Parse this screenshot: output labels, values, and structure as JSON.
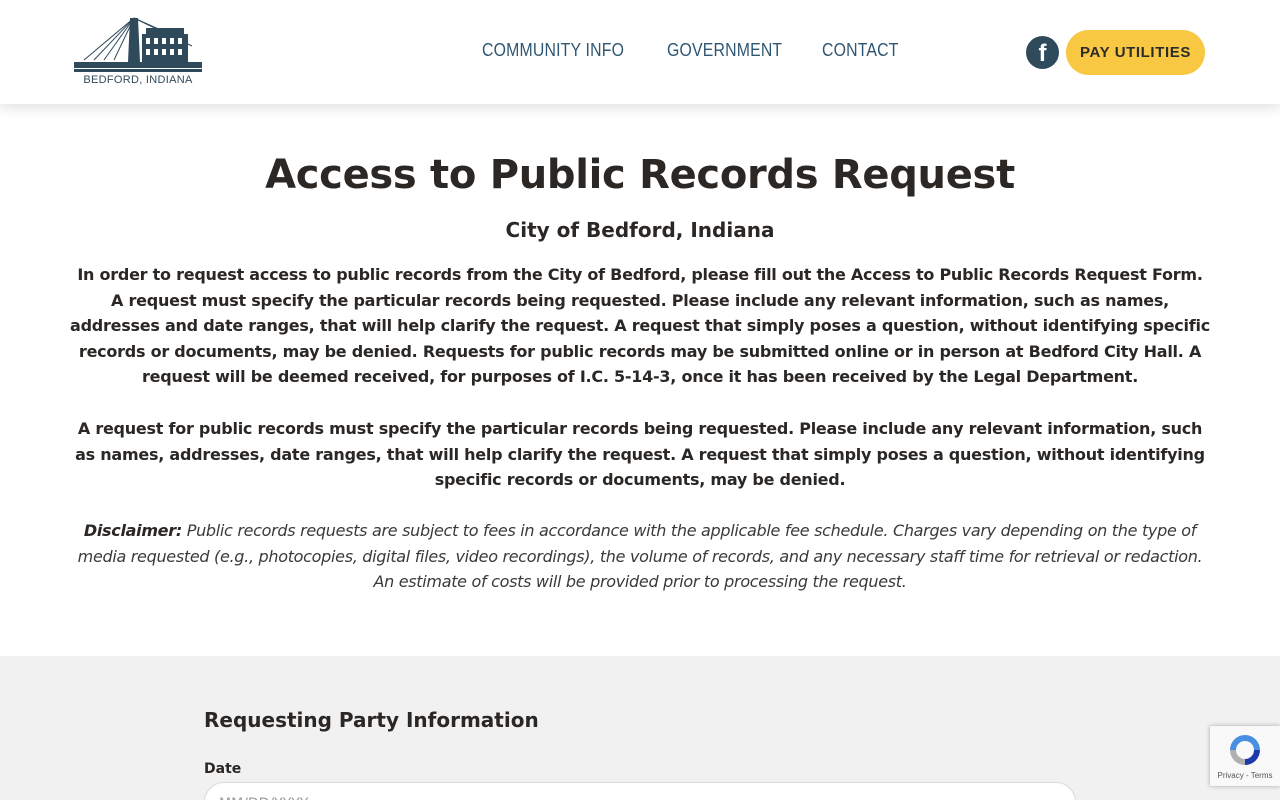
{
  "header": {
    "logo_text": "BEDFORD, INDIANA",
    "nav": [
      "COMMUNITY INFO",
      "GOVERNMENT",
      "CONTACT"
    ],
    "facebook_glyph": "f",
    "pay_button": "PAY UTILITIES"
  },
  "intro": {
    "title": "Access to Public Records Request",
    "subtitle": "City of Bedford, Indiana",
    "paragraph1": "In order to request access to public records from the City of Bedford, please fill out the Access to Public Records Request Form. A request must specify the particular records being requested. Please include any relevant information, such as names, addresses and date ranges, that will help clarify the request. A request that simply poses a question, without identifying specific records or documents, may be denied. Requests for public records may be submitted online or in person at Bedford City Hall. A request will be deemed received, for purposes of I.C. 5-14-3, once it has been received by the Legal Department.",
    "paragraph2": "A request for public records must specify the particular records being requested. Please include any relevant information, such as names, addresses, date ranges, that will help clarify the request. A request that simply poses a question, without identifying specific records or documents, may be denied.",
    "disclaimer_label": "Disclaimer:",
    "disclaimer_text": " Public records requests are subject to fees in accordance with the applicable fee schedule. Charges vary depending on the type of media requested (e.g., photocopies, digital files, video recordings), the volume of records, and any necessary staff time for retrieval or redaction. An estimate of costs will be provided prior to processing the request."
  },
  "form": {
    "section_title": "Requesting Party Information",
    "date_label": "Date",
    "date_placeholder": "MM/DD/YYYY"
  },
  "recaptcha": {
    "links": "Privacy - Terms"
  },
  "colors": {
    "brand_dark": "#2f4a5b",
    "nav_text": "#2f5672",
    "accent_yellow": "#f8c843",
    "form_background": "#f1f1f1"
  },
  "icons": [
    "bedford-logo-icon",
    "facebook-icon",
    "recaptcha-icon"
  ]
}
